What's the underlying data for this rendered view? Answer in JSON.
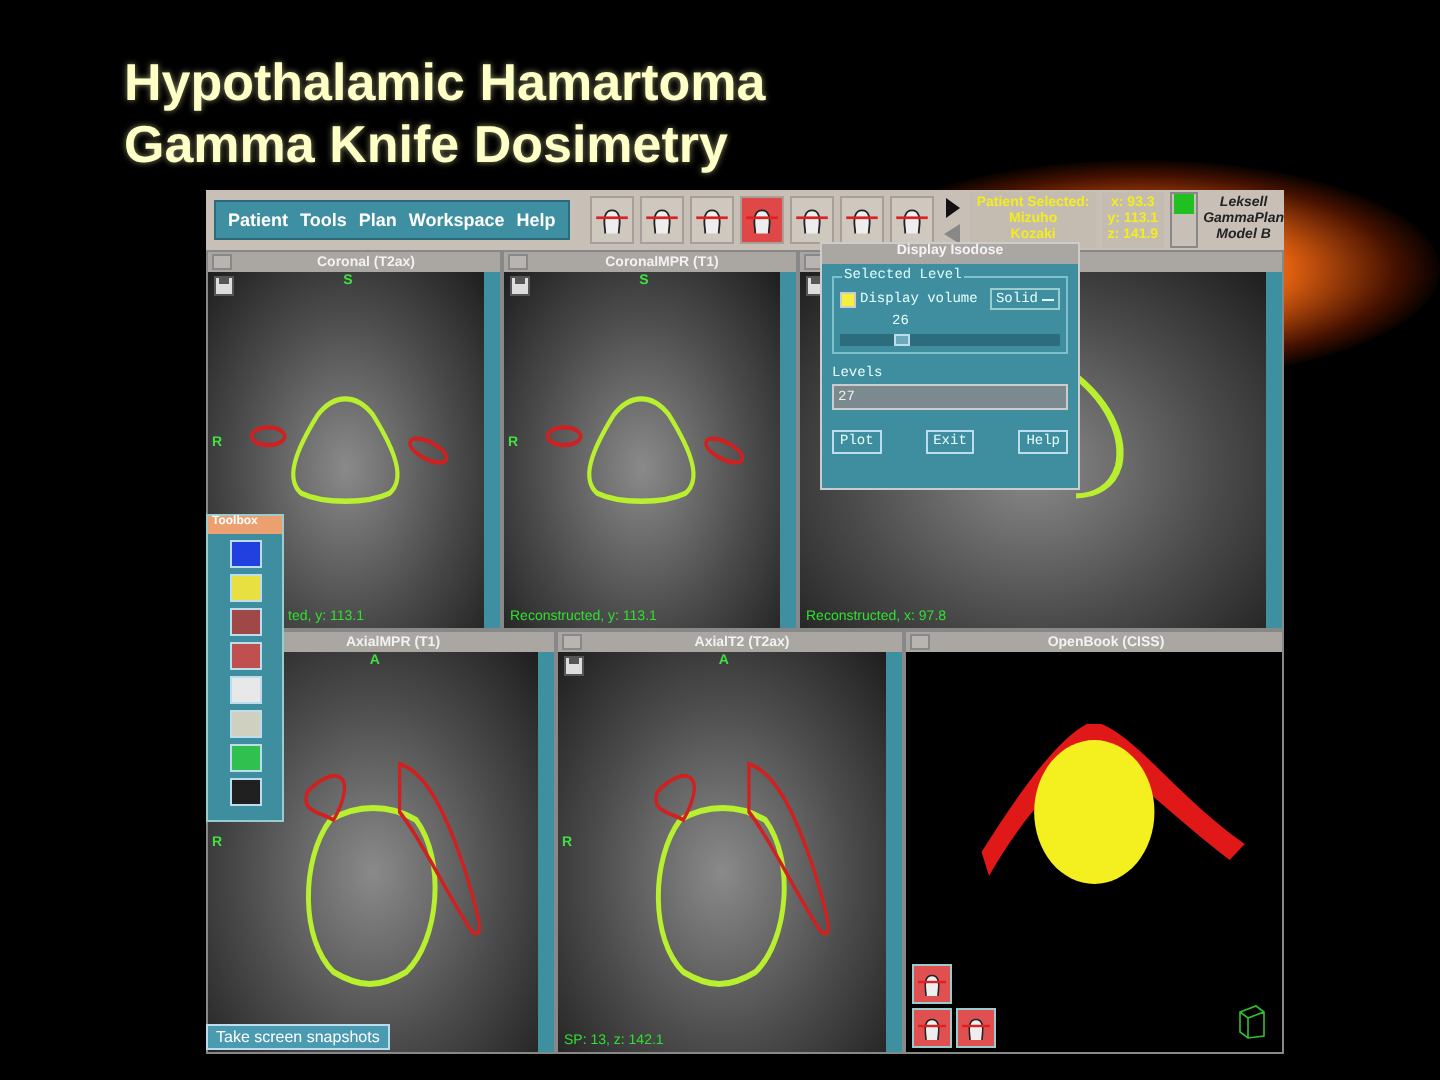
{
  "title": [
    "Hypothalamic Hamartoma",
    "Gamma Knife Dosimetry"
  ],
  "menu": [
    {
      "label": "Patient"
    },
    {
      "label": "Tools"
    },
    {
      "label": "Plan"
    },
    {
      "label": "Workspace"
    },
    {
      "label": "Help"
    }
  ],
  "view_buttons": [
    {
      "selected": false
    },
    {
      "selected": false
    },
    {
      "selected": false
    },
    {
      "selected": true
    },
    {
      "selected": false
    },
    {
      "selected": false
    },
    {
      "selected": false
    }
  ],
  "patient": {
    "label": "Patient Selected:",
    "first_name": "Mizuho",
    "last_name": "Kozaki"
  },
  "coords": [
    "x: 93.3",
    "y: 113.1",
    "z: 141.9"
  ],
  "logo": [
    "Leksell",
    "GammaPlan",
    "Model B"
  ],
  "top_views": [
    {
      "kind": "coronal",
      "title": "Coronal (T2ax)",
      "top_letter": "S",
      "left_letter": "R",
      "footer": "ted, y: 113.1"
    },
    {
      "kind": "coronal",
      "title": "CoronalMPR (T1)",
      "top_letter": "S",
      "left_letter": "R",
      "footer": "Reconstructed, y: 113.1"
    },
    {
      "kind": "sagittal",
      "footer": "Reconstructed, x: 97.8"
    }
  ],
  "bottom_views": [
    {
      "kind": "axial",
      "title": "AxialMPR (T1)",
      "top_letter": "A",
      "left_letter": "R"
    },
    {
      "kind": "axial",
      "title": "AxialT2 (T2ax)",
      "top_letter": "A",
      "left_letter": "R",
      "footer": "SP: 13, z: 142.1"
    },
    {
      "kind": "render",
      "title": "OpenBook (CISS)"
    }
  ],
  "dialog": {
    "title": "Display Isodose",
    "group": "Selected Level",
    "checkbox": {
      "label": "Display volume",
      "checked": true
    },
    "mode": "Solid",
    "slider": {
      "reading": "26",
      "level": 0.28
    },
    "levels_label": "Levels",
    "levels_value": "27",
    "buttons": [
      "Plot",
      "Exit",
      "Help"
    ]
  },
  "toolbox": {
    "title": "Toolbox"
  },
  "snapshot_button": "Take screen snapshots"
}
